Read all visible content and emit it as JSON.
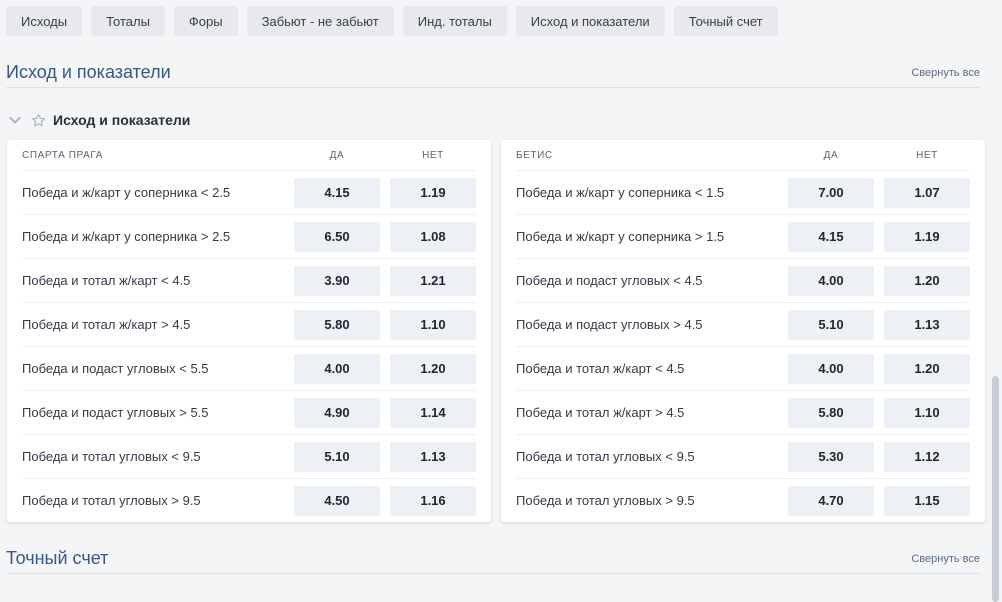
{
  "tabs": [
    "Исходы",
    "Тоталы",
    "Форы",
    "Забьют - не забьют",
    "Инд. тоталы",
    "Исход и показатели",
    "Точный счет"
  ],
  "section1": {
    "title": "Исход и показатели",
    "collapse": "Свернуть все"
  },
  "group": {
    "title": "Исход и показатели"
  },
  "left": {
    "team": "СПАРТА ПРАГА",
    "yes": "ДА",
    "no": "НЕТ",
    "rows": [
      {
        "label": "Победа и ж/карт у соперника < 2.5",
        "yes": "4.15",
        "no": "1.19"
      },
      {
        "label": "Победа и ж/карт у соперника > 2.5",
        "yes": "6.50",
        "no": "1.08"
      },
      {
        "label": "Победа и тотал ж/карт < 4.5",
        "yes": "3.90",
        "no": "1.21"
      },
      {
        "label": "Победа и тотал ж/карт > 4.5",
        "yes": "5.80",
        "no": "1.10"
      },
      {
        "label": "Победа и подаст угловых < 5.5",
        "yes": "4.00",
        "no": "1.20"
      },
      {
        "label": "Победа и подаст угловых > 5.5",
        "yes": "4.90",
        "no": "1.14"
      },
      {
        "label": "Победа и тотал угловых < 9.5",
        "yes": "5.10",
        "no": "1.13"
      },
      {
        "label": "Победа и тотал угловых > 9.5",
        "yes": "4.50",
        "no": "1.16"
      }
    ]
  },
  "right": {
    "team": "БЕТИС",
    "yes": "ДА",
    "no": "НЕТ",
    "rows": [
      {
        "label": "Победа и ж/карт у соперника < 1.5",
        "yes": "7.00",
        "no": "1.07"
      },
      {
        "label": "Победа и ж/карт у соперника > 1.5",
        "yes": "4.15",
        "no": "1.19"
      },
      {
        "label": "Победа и подаст угловых < 4.5",
        "yes": "4.00",
        "no": "1.20"
      },
      {
        "label": "Победа и подаст угловых > 4.5",
        "yes": "5.10",
        "no": "1.13"
      },
      {
        "label": "Победа и тотал ж/карт < 4.5",
        "yes": "4.00",
        "no": "1.20"
      },
      {
        "label": "Победа и тотал ж/карт > 4.5",
        "yes": "5.80",
        "no": "1.10"
      },
      {
        "label": "Победа и тотал угловых < 9.5",
        "yes": "5.30",
        "no": "1.12"
      },
      {
        "label": "Победа и тотал угловых > 9.5",
        "yes": "4.70",
        "no": "1.15"
      }
    ]
  },
  "section2": {
    "title": "Точный счет",
    "collapse": "Свернуть все"
  },
  "colors": {
    "sectionTitle": "#3a5683",
    "accent": "#2b6fd6"
  },
  "icons": {
    "chevron": "chevron-down-icon",
    "star": "star-icon"
  }
}
